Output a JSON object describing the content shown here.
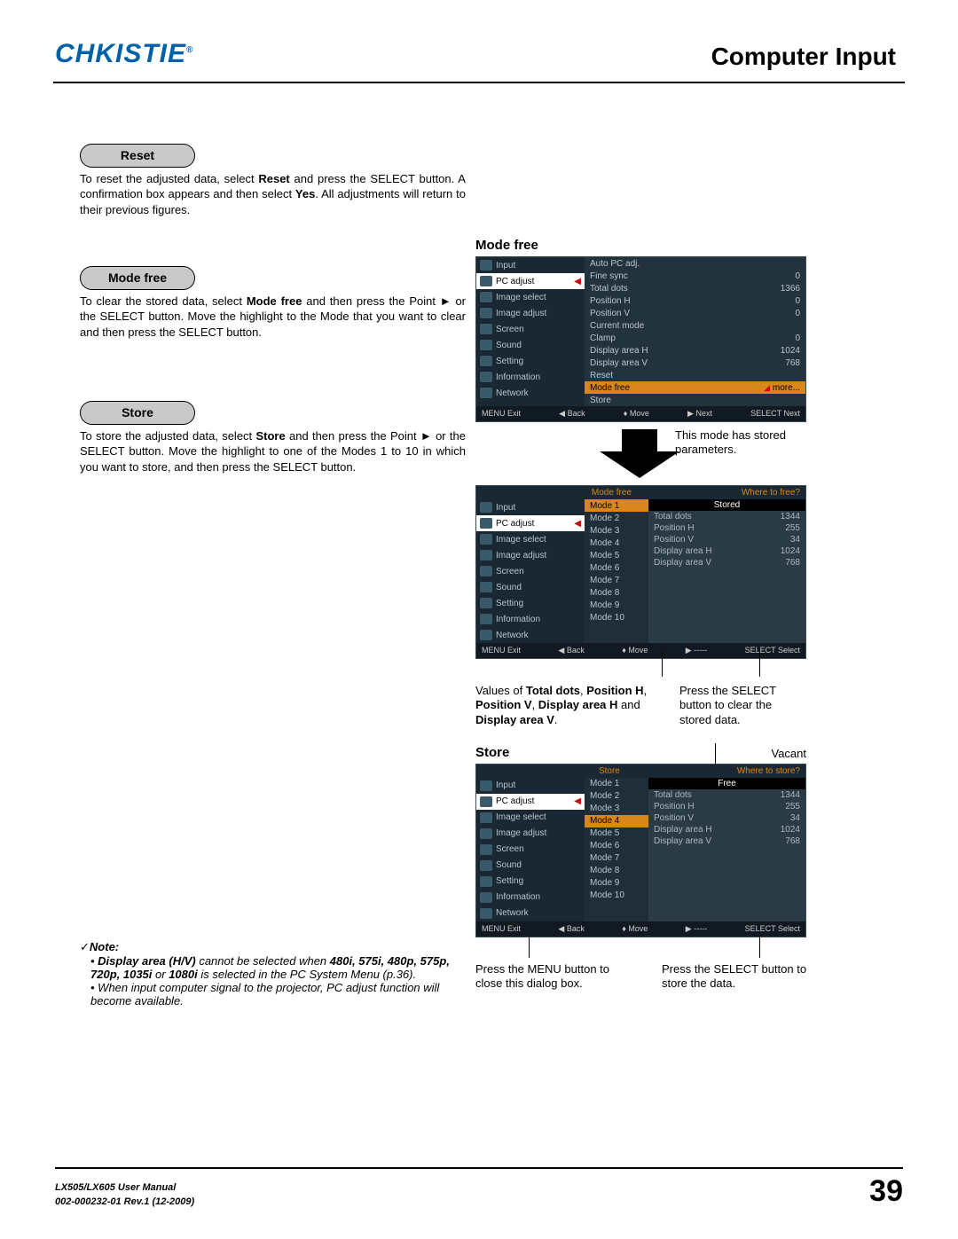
{
  "header": {
    "logo": "CHKISTIE",
    "title": "Computer Input"
  },
  "sections": {
    "reset": {
      "label": "Reset",
      "body_pre": "To reset the adjusted data, select ",
      "b1": "Reset",
      "body_mid": " and press the SELECT button. A confirmation box appears and then select ",
      "b2": "Yes",
      "body_post": ". All adjustments will return to their previous figures."
    },
    "modefree": {
      "label": "Mode free",
      "body_pre": "To clear the stored data, select ",
      "b1": "Mode free",
      "body_post": " and then press the Point ► or the SELECT button. Move the highlight to the Mode that you want to clear and then press the SELECT button."
    },
    "store": {
      "label": "Store",
      "body_pre": "To store the adjusted data, select ",
      "b1": "Store",
      "body_post": " and then press the Point ► or the SELECT button. Move the highlight to one of the Modes 1 to 10 in which you want to store, and then press the SELECT button."
    }
  },
  "note": {
    "title": "Note:",
    "item1_pre": "Display area (H/V)",
    "item1_mid": " cannot be selected when ",
    "item1_b": "480i, 575i, 480p, 575p, 720p, 1035i",
    "item1_or": " or ",
    "item1_b2": "1080i",
    "item1_post": " is selected in the PC System Menu (p.36).",
    "item2": "When input computer signal to the projector, PC adjust function will become available."
  },
  "right": {
    "modefree_title": "Mode free",
    "store_title": "Store",
    "this_mode": "This mode has stored parameters.",
    "vacant": "Vacant",
    "callout_values_pre": "Values of ",
    "callout_values_b1": "Total dots",
    "callout_values_c": ", ",
    "callout_values_b2": "Position H",
    "callout_values_b3": "Position V",
    "callout_values_b4": "Display area H",
    "callout_values_and": " and ",
    "callout_values_b5": "Display area V",
    "callout_values_post": ".",
    "callout_select": "Press the SELECT button to clear the stored data.",
    "callout_menu": "Press the MENU button to close this dialog box.",
    "callout_store_select": "Press the SELECT button to store the data."
  },
  "osd": {
    "side": [
      "Input",
      "PC adjust",
      "Image select",
      "Image adjust",
      "Screen",
      "Sound",
      "Setting",
      "Information",
      "Network"
    ],
    "lines1": [
      {
        "l": "Auto PC adj.",
        "v": ""
      },
      {
        "l": "Fine sync",
        "v": "0"
      },
      {
        "l": "Total dots",
        "v": "1366"
      },
      {
        "l": "Position H",
        "v": "0"
      },
      {
        "l": "Position V",
        "v": "0"
      },
      {
        "l": "Current mode",
        "v": ""
      },
      {
        "l": "Clamp",
        "v": "0"
      },
      {
        "l": "Display area H",
        "v": "1024"
      },
      {
        "l": "Display area V",
        "v": "768"
      },
      {
        "l": "Reset",
        "v": ""
      }
    ],
    "hl1": {
      "l": "Mode free",
      "v": "more..."
    },
    "after_hl1": {
      "l": "Store",
      "v": ""
    },
    "foot": {
      "exit": "MENU Exit",
      "back": "◀ Back",
      "move": "♦ Move",
      "next": "▶ Next",
      "sel": "SELECT Next"
    },
    "foot2": {
      "exit": "MENU Exit",
      "back": "◀ Back",
      "move": "♦ Move",
      "next": "▶ -----",
      "sel": "SELECT Select"
    },
    "top2": {
      "l": "Mode free",
      "r": "Where to free?"
    },
    "stored_head": "Stored",
    "modes": [
      "Mode 1",
      "Mode 2",
      "Mode 3",
      "Mode 4",
      "Mode 5",
      "Mode 6",
      "Mode 7",
      "Mode 8",
      "Mode 9",
      "Mode 10"
    ],
    "stored": [
      {
        "l": "Total dots",
        "v": "1344"
      },
      {
        "l": "Position H",
        "v": "255"
      },
      {
        "l": "Position V",
        "v": "34"
      },
      {
        "l": "Display area H",
        "v": "1024"
      },
      {
        "l": "Display area V",
        "v": "768"
      }
    ],
    "top3": {
      "l": "Store",
      "r": "Where to store?"
    },
    "free_head": "Free"
  },
  "footer": {
    "manual": "LX505/LX605 User Manual",
    "rev": "002-000232-01 Rev.1 (12-2009)",
    "page": "39"
  }
}
